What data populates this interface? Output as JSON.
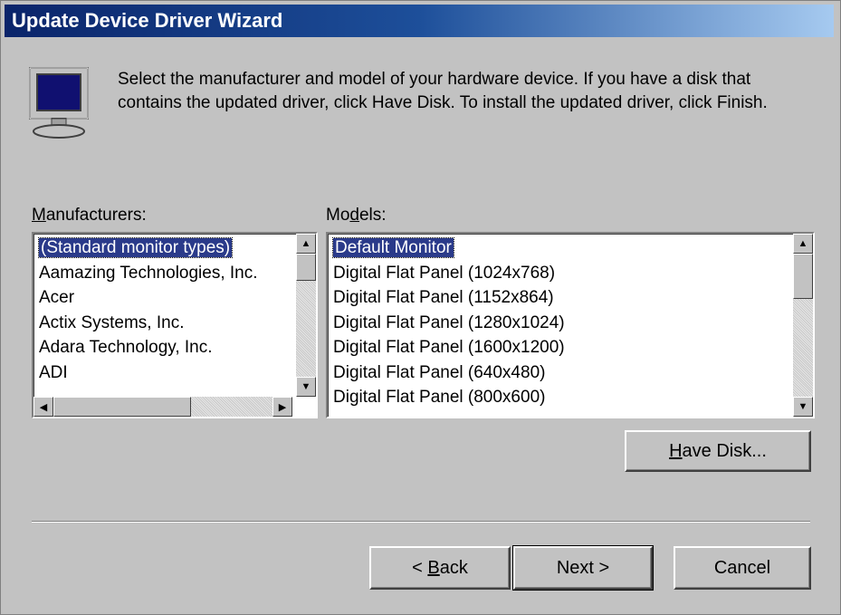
{
  "window": {
    "title": "Update Device Driver Wizard"
  },
  "intro": {
    "text": "Select the manufacturer and model of your hardware device. If you have a disk that contains the updated driver, click Have Disk. To install the updated driver, click Finish."
  },
  "manufacturers": {
    "label_prefix": "",
    "label_underline": "M",
    "label_rest": "anufacturers:",
    "items": [
      "(Standard monitor types)",
      "Aamazing Technologies, Inc.",
      "Acer",
      "Actix Systems, Inc.",
      "Adara Technology, Inc.",
      "ADI"
    ],
    "selected": "(Standard monitor types)"
  },
  "models": {
    "label_prefix": "Mo",
    "label_underline": "d",
    "label_rest": "els:",
    "items": [
      "Default Monitor",
      "Digital Flat Panel (1024x768)",
      "Digital Flat Panel (1152x864)",
      "Digital Flat Panel (1280x1024)",
      "Digital Flat Panel (1600x1200)",
      "Digital Flat Panel (640x480)",
      "Digital Flat Panel (800x600)"
    ],
    "selected": "Default Monitor"
  },
  "buttons": {
    "have_disk_underline": "H",
    "have_disk_rest": "ave Disk...",
    "back_prefix": "< ",
    "back_underline": "B",
    "back_rest": "ack",
    "next": "Next >",
    "cancel": "Cancel"
  },
  "icons": {
    "monitor": "monitor-icon",
    "scroll_up": "arrow-up-icon",
    "scroll_down": "arrow-down-icon",
    "scroll_left": "arrow-left-icon",
    "scroll_right": "arrow-right-icon"
  },
  "colors": {
    "selection": "#2a3a8a",
    "title_start": "#0a246a",
    "title_end": "#a6caf0"
  }
}
